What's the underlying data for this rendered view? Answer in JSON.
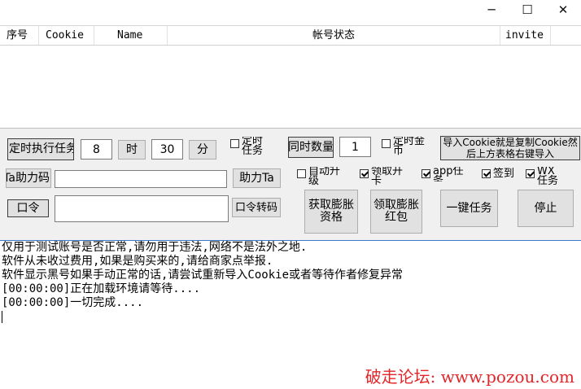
{
  "window": {
    "minimize": "─",
    "maximize": "☐",
    "close": "✕"
  },
  "grid": {
    "columns": [
      "序号",
      "Cookie",
      "Name",
      "帐号状态",
      "invite"
    ]
  },
  "controls": {
    "timer_button": "定时执行任务",
    "hour_value": "8",
    "hour_button": "时",
    "minute_value": "30",
    "minute_button": "分",
    "timed_task_check": "定时任务",
    "concurrent_button": "同时数量",
    "concurrent_value": "1",
    "timed_coin_check": "定时金币",
    "import_hint_button": "导入Cookie就是复制Cookie然后上方表格右键导入",
    "help_ta_left": "Ta助力码",
    "help_ta_button": "助力Ta",
    "auto_upgrade_check": "自动升级",
    "draw_card_check": "领取开卡",
    "app_task_check": "app任务",
    "sign_in_check": "签到",
    "wx_task_check": "WX任务",
    "token_button": "口令",
    "token_convert_button": "口令转码",
    "get_expand_button": "获取膨胀资格",
    "get_red_button": "领取膨胀红包",
    "one_click_button": "一键任务",
    "stop_button": "停止"
  },
  "log": {
    "lines": [
      "仅用于测试账号是否正常,请勿用于违法,网络不是法外之地.",
      "软件从未收过费用,如果是购买来的,请给商家点举报.",
      "软件显示黑号如果手动正常的话,请尝试重新导入Cookie或者等待作者修复异常",
      "[00:00:00]正在加载环境请等待....",
      "[00:00:00]一切完成...."
    ],
    "watermark": "破走论坛: www.pozou.com"
  },
  "colors": {
    "accent": "#3a78c8",
    "watermark": "#e2262b"
  }
}
